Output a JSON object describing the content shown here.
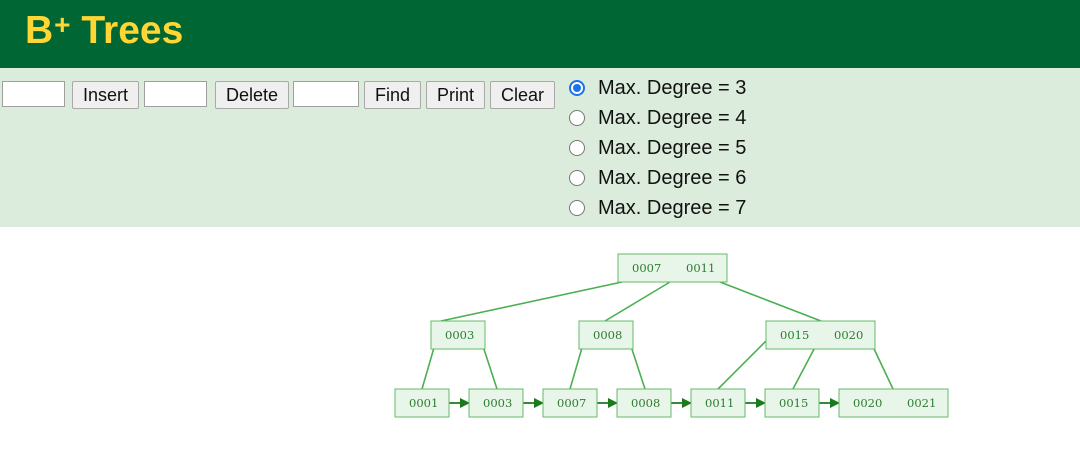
{
  "header": {
    "title": "B",
    "title_sup": "+",
    "title_rest": " Trees"
  },
  "controls": {
    "insert_value": "",
    "insert_label": "Insert",
    "delete_value": "",
    "delete_label": "Delete",
    "find_value": "",
    "find_label": "Find",
    "print_label": "Print",
    "clear_label": "Clear"
  },
  "degree_options": [
    {
      "label": "Max. Degree = 3",
      "checked": true
    },
    {
      "label": "Max. Degree = 4",
      "checked": false
    },
    {
      "label": "Max. Degree = 5",
      "checked": false
    },
    {
      "label": "Max. Degree = 6",
      "checked": false
    },
    {
      "label": "Max. Degree = 7",
      "checked": false
    }
  ],
  "tree": {
    "colors": {
      "node_fill": "#e8f5e9",
      "node_stroke": "#66bb6a",
      "edge": "#4caf50",
      "arrow": "#1b7a1b",
      "text": "#2e7d32"
    },
    "root": {
      "keys": [
        "0007",
        "0011"
      ]
    },
    "internal": [
      {
        "keys": [
          "0003"
        ]
      },
      {
        "keys": [
          "0008"
        ]
      },
      {
        "keys": [
          "0015",
          "0020"
        ]
      }
    ],
    "leaves": [
      {
        "keys": [
          "0001"
        ]
      },
      {
        "keys": [
          "0003"
        ]
      },
      {
        "keys": [
          "0007"
        ]
      },
      {
        "keys": [
          "0008"
        ]
      },
      {
        "keys": [
          "0011"
        ]
      },
      {
        "keys": [
          "0015"
        ]
      },
      {
        "keys": [
          "0020",
          "0021"
        ]
      }
    ]
  }
}
